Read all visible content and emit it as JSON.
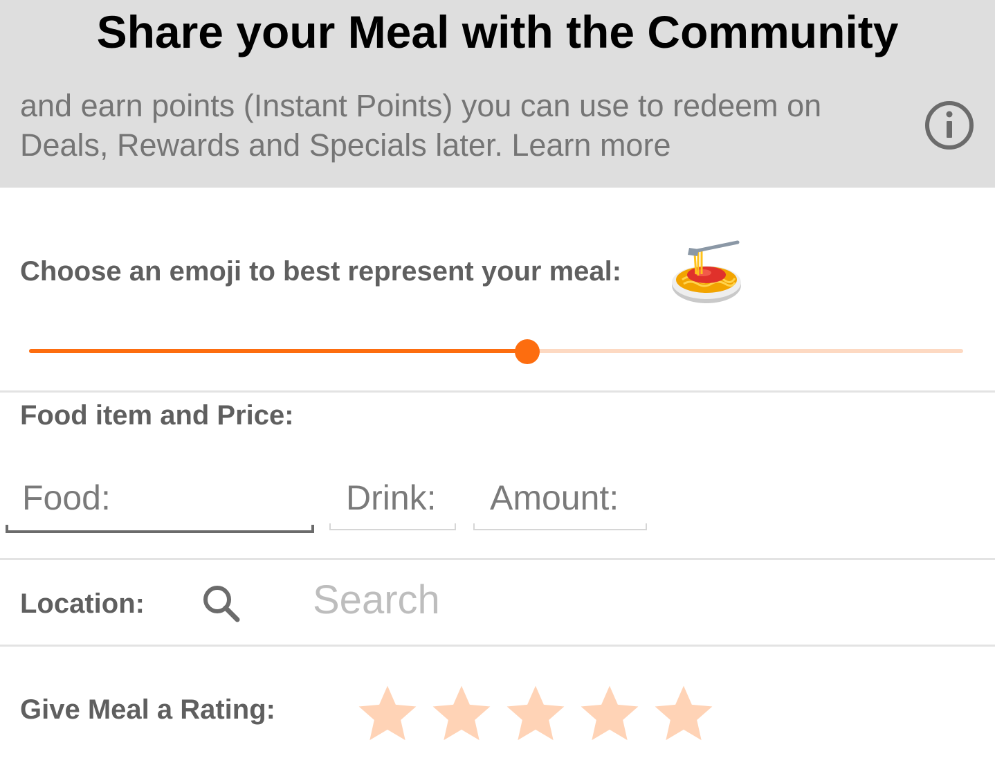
{
  "header": {
    "title": "Share your Meal with the Community",
    "subtitle": "and earn points (Instant Points) you can use to redeem on Deals, Rewards and Specials later. Learn more",
    "info_icon": "info-circle-icon"
  },
  "emoji_picker": {
    "label": "Choose an emoji to best represent your meal:",
    "selected_emoji": "spaghetti",
    "slider_value_fraction": 0.533,
    "accent_color": "#fd6d0f",
    "track_color": "#fdd9c2"
  },
  "food_section": {
    "label": "Food item and Price:",
    "food_placeholder": "Food:",
    "drink_placeholder": "Drink:",
    "amount_placeholder": "Amount:"
  },
  "location": {
    "label": "Location:",
    "search_icon": "search-icon",
    "search_placeholder": "Search"
  },
  "rating": {
    "label": "Give Meal a Rating:",
    "max_stars": 5,
    "selected_stars": 0,
    "star_color": "#ffd3b6"
  }
}
